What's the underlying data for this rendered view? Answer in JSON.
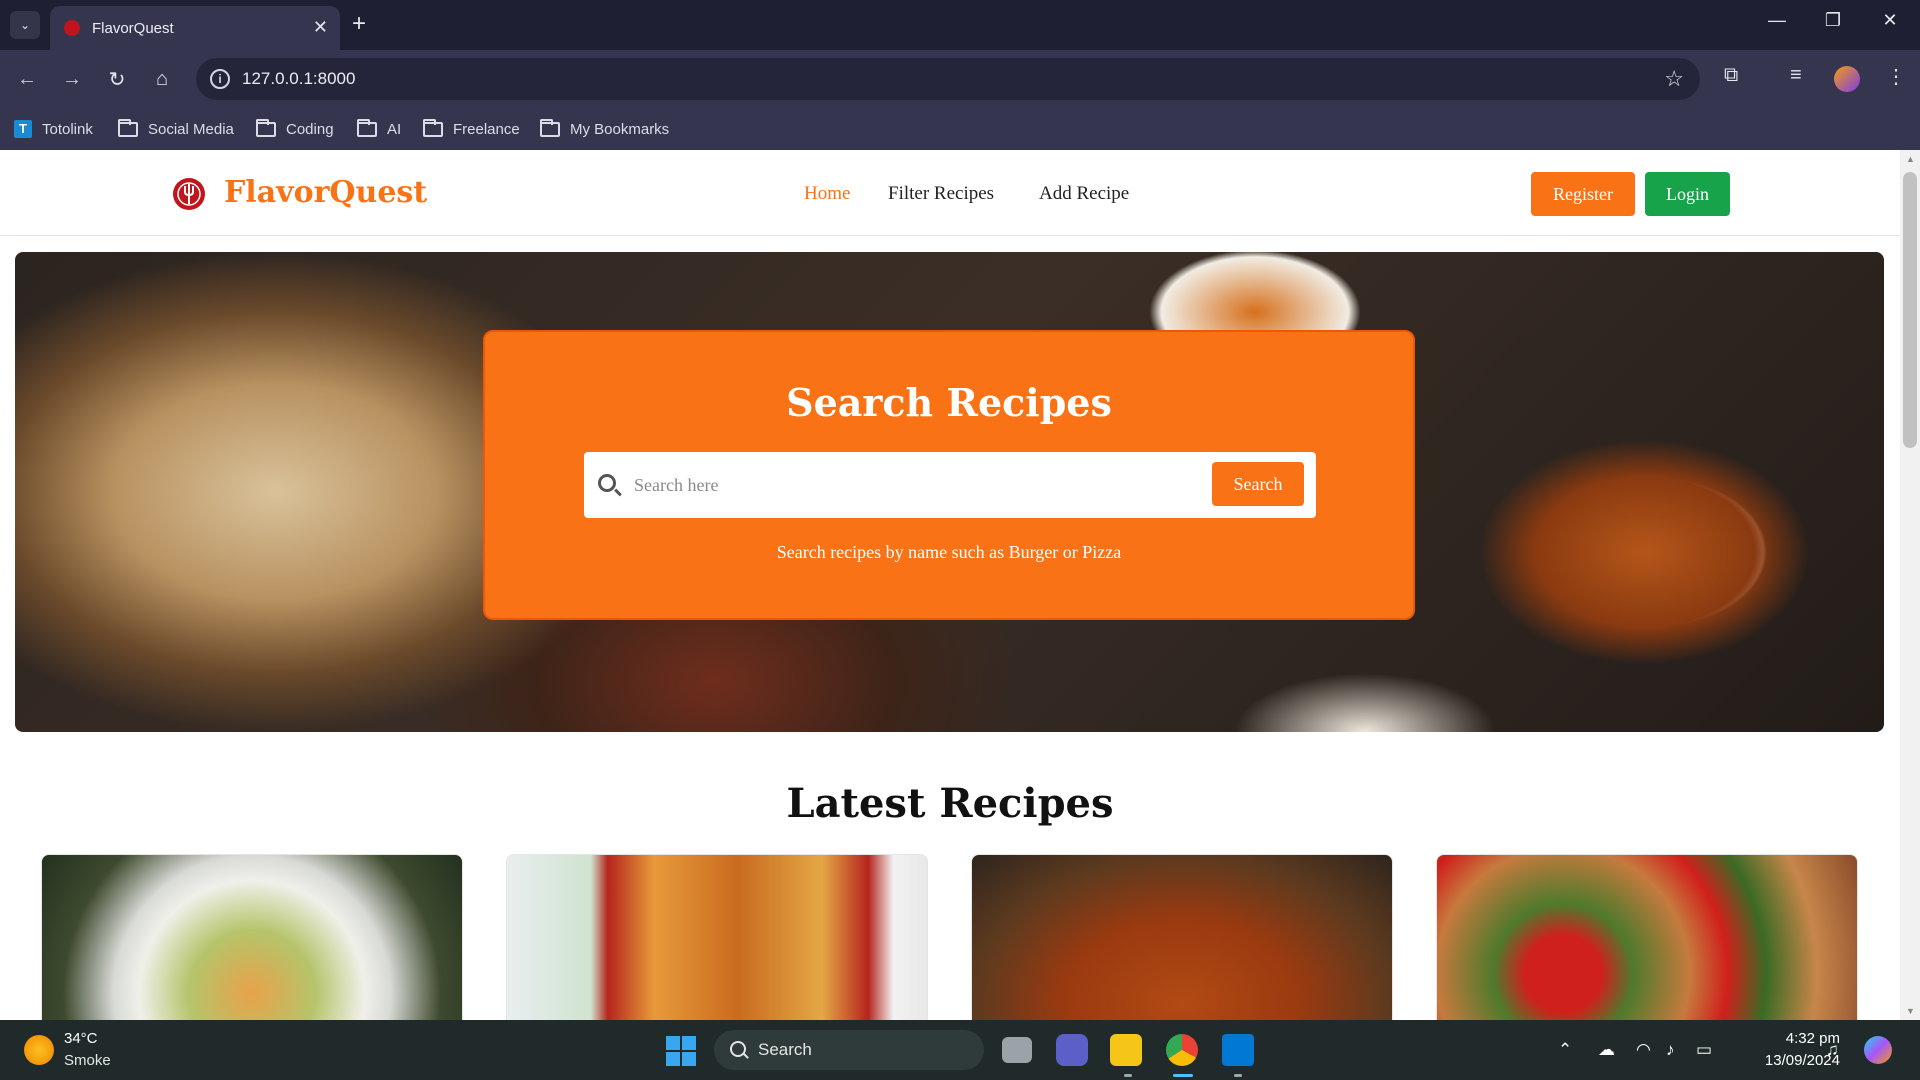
{
  "browser": {
    "tab_title": "FlavorQuest",
    "url": "127.0.0.1:8000",
    "bookmarks": [
      {
        "label": "Totolink",
        "icon": "totolink-favicon"
      },
      {
        "label": "Social Media",
        "icon": "folder-icon"
      },
      {
        "label": "Coding",
        "icon": "folder-icon"
      },
      {
        "label": "AI",
        "icon": "folder-icon"
      },
      {
        "label": "Freelance",
        "icon": "folder-icon"
      },
      {
        "label": "My Bookmarks",
        "icon": "folder-icon"
      }
    ]
  },
  "site": {
    "brand": "FlavorQuest",
    "brand_color": "#f97316",
    "nav": [
      {
        "label": "Home",
        "active": true
      },
      {
        "label": "Filter Recipes",
        "active": false
      },
      {
        "label": "Add Recipe",
        "active": false
      }
    ],
    "register_label": "Register",
    "login_label": "Login",
    "register_color": "#f97316",
    "login_color": "#16a34a"
  },
  "hero": {
    "title": "Search Recipes",
    "search_placeholder": "Search here",
    "search_value": "",
    "search_button": "Search",
    "hint": "Search recipes by name such as Burger or Pizza"
  },
  "latest": {
    "title": "Latest Recipes"
  },
  "taskbar": {
    "weather_temp": "34°C",
    "weather_desc": "Smoke",
    "search_label": "Search",
    "time": "4:32 pm",
    "date": "13/09/2024"
  }
}
